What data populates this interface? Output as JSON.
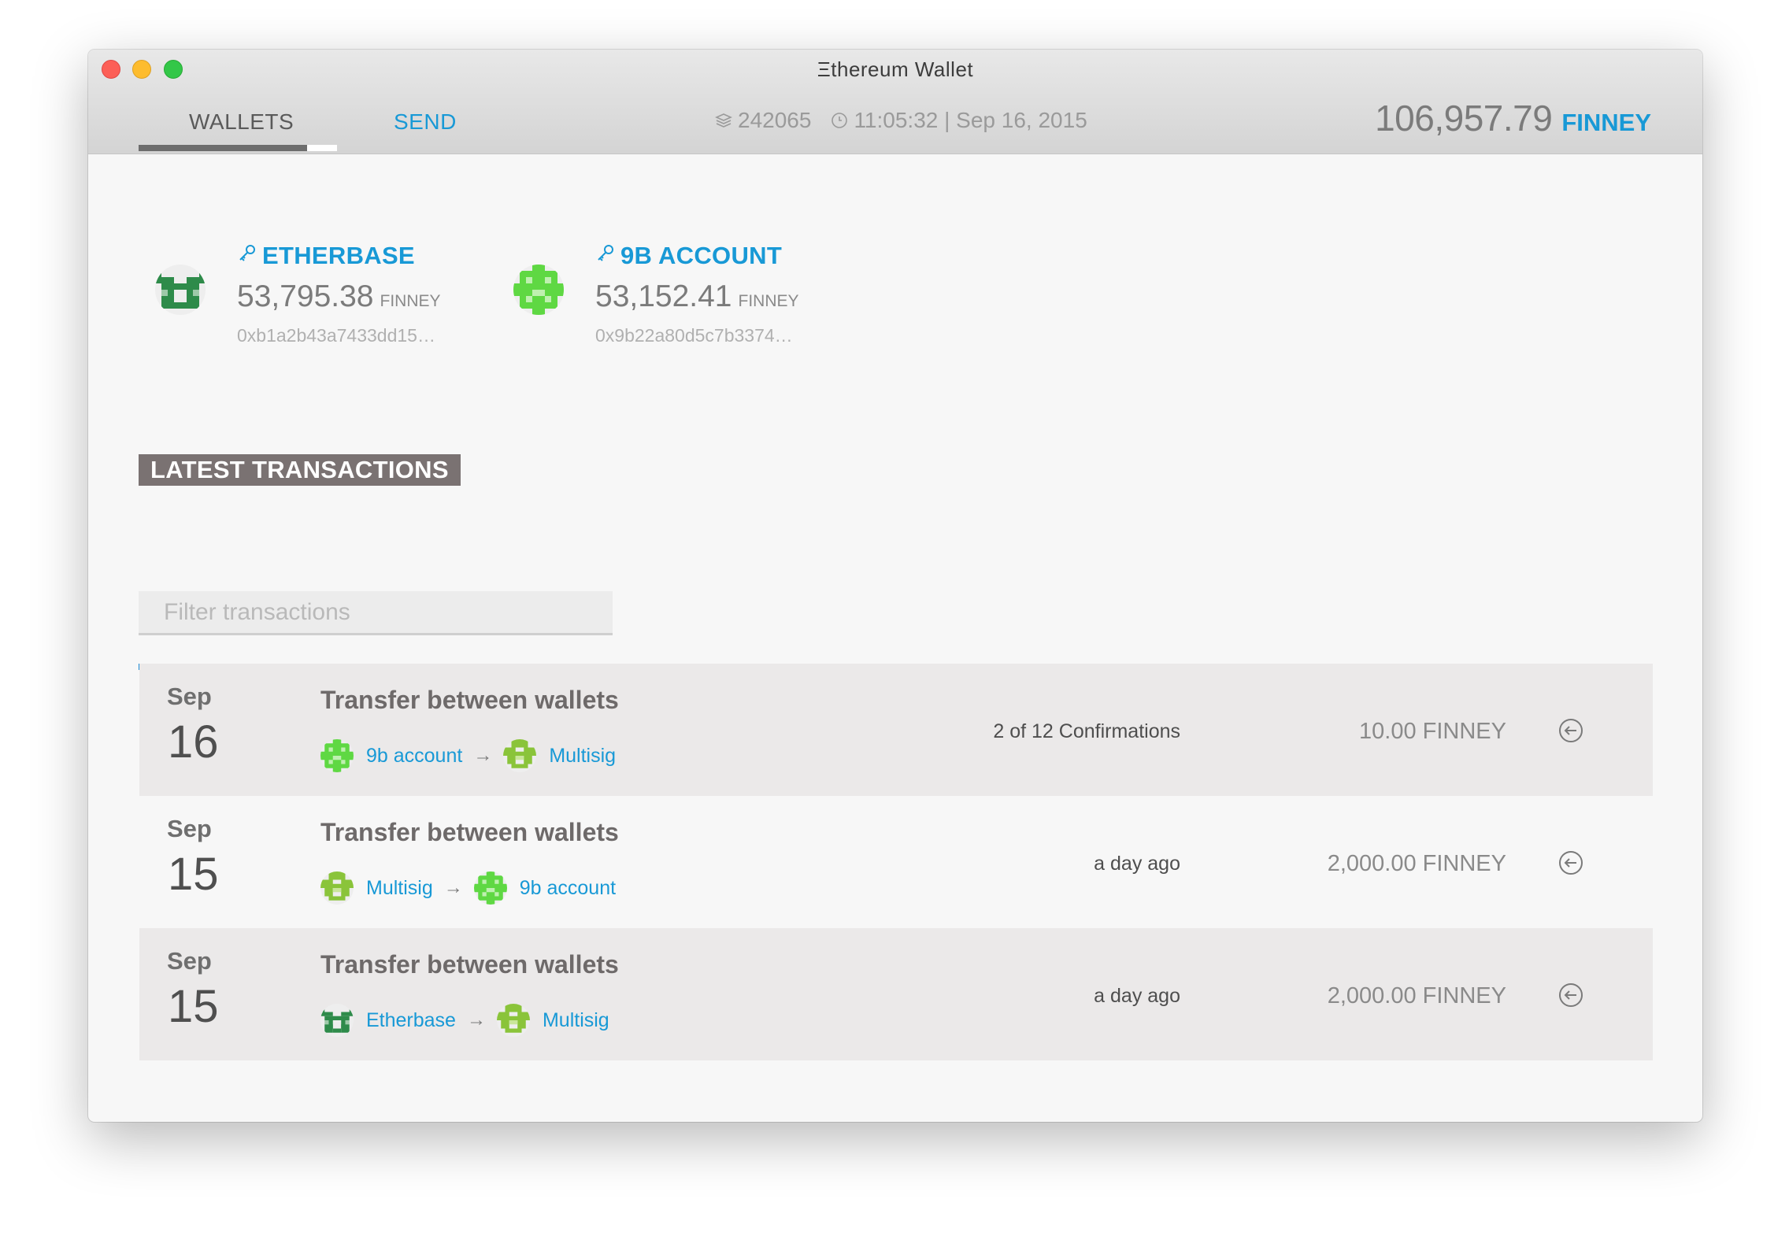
{
  "window": {
    "title": "Ξthereum Wallet"
  },
  "nav": {
    "tabs": [
      {
        "label": "WALLETS",
        "active": true
      },
      {
        "label": "SEND",
        "active": false
      }
    ]
  },
  "status": {
    "block_number": "242065",
    "time": "11:05:32 | Sep 16, 2015"
  },
  "total_balance": {
    "value": "106,957.79",
    "unit": "FINNEY"
  },
  "colors": {
    "accent": "#1899d6",
    "section_bg": "#7a7272",
    "progress": "#1b8ad5",
    "row_shaded": "#ebe9e9"
  },
  "accounts": [
    {
      "name": "ETHERBASE",
      "balance": "53,795.38",
      "unit": "FINNEY",
      "address": "0xb1a2b43a7433dd15…",
      "icon": "key-icon",
      "avatar": "etherbase-identicon"
    },
    {
      "name": "9B ACCOUNT",
      "balance": "53,152.41",
      "unit": "FINNEY",
      "address": "0x9b22a80d5c7b3374…",
      "icon": "key-icon",
      "avatar": "9b-account-identicon"
    }
  ],
  "transactions_section": {
    "title": "LATEST TRANSACTIONS",
    "filter_placeholder": "Filter transactions",
    "rows": [
      {
        "month": "Sep",
        "day": "16",
        "title": "Transfer between wallets",
        "from": "9b account",
        "to": "Multisig",
        "status": "2 of 12 Confirmations",
        "amount": "10.00 FINNEY"
      },
      {
        "month": "Sep",
        "day": "15",
        "title": "Transfer between wallets",
        "from": "Multisig",
        "to": "9b account",
        "status": "a day ago",
        "amount": "2,000.00 FINNEY"
      },
      {
        "month": "Sep",
        "day": "15",
        "title": "Transfer between wallets",
        "from": "Etherbase",
        "to": "Multisig",
        "status": "a day ago",
        "amount": "2,000.00 FINNEY"
      }
    ]
  }
}
